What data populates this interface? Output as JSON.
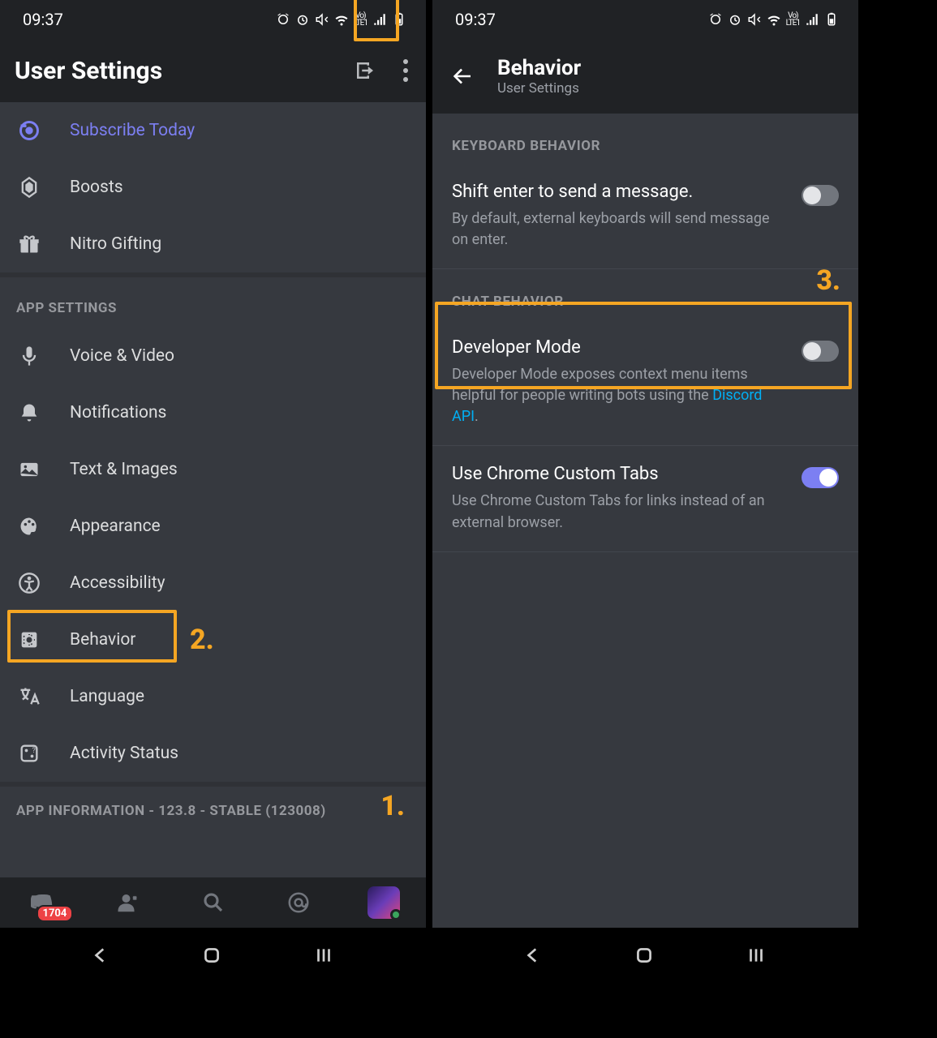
{
  "status": {
    "time": "09:37"
  },
  "left": {
    "title": "User Settings",
    "sections": {
      "nitro": [
        {
          "label": "Subscribe Today"
        },
        {
          "label": "Boosts"
        },
        {
          "label": "Nitro Gifting"
        }
      ],
      "app_head": "APP SETTINGS",
      "app": [
        {
          "label": "Voice & Video"
        },
        {
          "label": "Notifications"
        },
        {
          "label": "Text & Images"
        },
        {
          "label": "Appearance"
        },
        {
          "label": "Accessibility"
        },
        {
          "label": "Behavior"
        },
        {
          "label": "Language"
        },
        {
          "label": "Activity Status"
        }
      ],
      "info_head": "APP INFORMATION - 123.8 - STABLE (123008)"
    },
    "badge": "1704"
  },
  "right": {
    "title": "Behavior",
    "subtitle": "User Settings",
    "kb_head": "KEYBOARD BEHAVIOR",
    "kb": {
      "title": "Shift enter to send a message.",
      "desc": "By default, external keyboards will send message on enter."
    },
    "chat_head": "CHAT BEHAVIOR",
    "dev": {
      "title": "Developer Mode",
      "desc1": "Developer Mode exposes context menu items helpful for people writing bots using the ",
      "link": "Discord API",
      "desc2": "."
    },
    "chrome": {
      "title": "Use Chrome Custom Tabs",
      "desc": "Use Chrome Custom Tabs for links instead of an external browser."
    }
  },
  "annotations": {
    "n1": "1.",
    "n2": "2.",
    "n3": "3."
  }
}
